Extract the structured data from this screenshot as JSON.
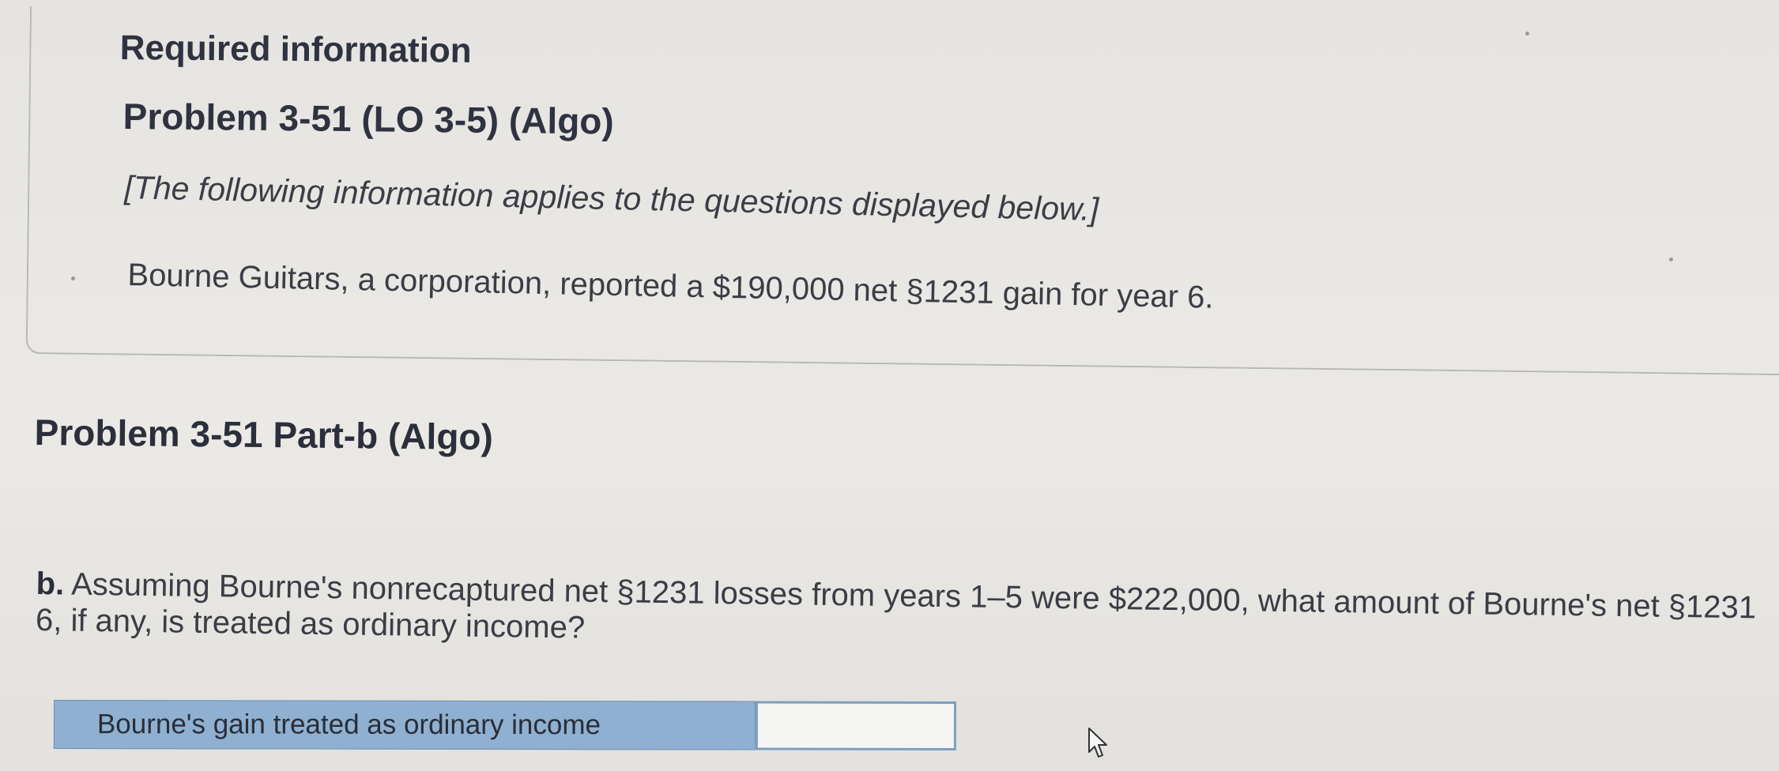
{
  "info": {
    "required_title": "Required information",
    "problem_title": "Problem 3-51 (LO 3-5) (Algo)",
    "intro_note": "[The following information applies to the questions displayed below.]",
    "scenario": "Bourne Guitars, a corporation, reported a $190,000 net §1231 gain for year 6."
  },
  "part": {
    "title": "Problem 3-51 Part-b (Algo)",
    "question_label": "b.",
    "question_line1": "Assuming Bourne's nonrecaptured net §1231 losses from years 1–5 were $222,000, what amount of Bourne's net §1231",
    "question_line2": "6, if any, is treated as ordinary income?"
  },
  "answer": {
    "row_label": "Bourne's gain treated as ordinary income",
    "value": ""
  },
  "icons": {
    "cursor": "mouse-pointer-icon"
  },
  "colors": {
    "answer_label_bg": "#8fb0d0",
    "answer_input_border": "#7f9ec0"
  }
}
